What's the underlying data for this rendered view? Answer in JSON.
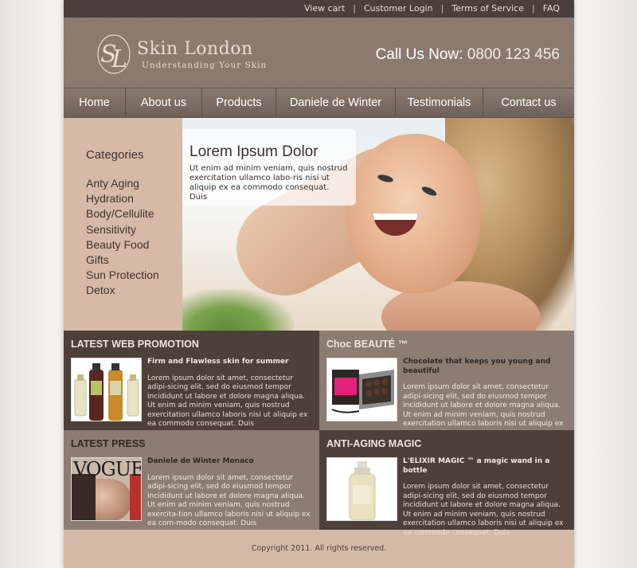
{
  "topbar": {
    "links": [
      "View cart",
      "Customer Login",
      "Terms of Service",
      "FAQ"
    ]
  },
  "header": {
    "logo_name": "Skin London",
    "logo_tagline": "Understanding Your Skin",
    "phone_label": "Call Us Now:",
    "phone_number": "0800 123 456"
  },
  "nav": {
    "items": [
      "Home",
      "About us",
      "Products",
      "Daniele de Winter",
      "Testimonials",
      "Contact us"
    ]
  },
  "categories": {
    "title": "Categories",
    "items": [
      "Anty Aging",
      "Hydration",
      "Body/Cellulite",
      "Sensitivity",
      "Beauty Food",
      "Gifts",
      "Sun Protection",
      "Detox"
    ]
  },
  "hero": {
    "title": "Lorem Ipsum Dolor",
    "text": "Ut enim ad minim veniam, quis nostrud exercitation ullamco labo-ris nisi ut aliquip ex ea commodo consequat. Duis"
  },
  "boxes": {
    "promo": {
      "title": "LATEST WEB PROMOTION",
      "subtitle": "Firm and Flawless skin for summer",
      "text": "Lorem ipsum dolor sit amet, consectetur adipi-sicing elit, sed do eiusmod tempor incididunt ut labore et dolore magna aliqua. Ut enim ad minim veniam, quis nostrud exercitation ullamco laboris nisi ut aliquip ex ea commodo consequat. Duis"
    },
    "choc": {
      "title": "Choc BEAUTÉ ™",
      "subtitle": "Chocolate that keeps you young and beautiful",
      "text": "Lorem ipsum dolor sit amet, consectetur adipi-sicing elit, sed do eiusmod tempor incididunt ut labore et dolore magna aliqua. Ut enim ad minim veniam, quis nostrud exercitation ullamco laboris nisi ut aliquip ex ea commodo consequat."
    },
    "press": {
      "title": "LATEST PRESS",
      "subtitle": "Daniele de Winter Monaco",
      "text": "Lorem ipsum dolor sit amet, consectetur adipi-sicing elit, sed do eiusmod tempor incididunt ut labore et dolore magna aliqua. Ut enim ad minim veniam, quis nostrud exercita-tion ullamco laboris nisi ut aliquip ex ea com-modo consequat. Duis",
      "magazine": "VOGUE"
    },
    "antiaging": {
      "title": "ANTI-AGING MAGIC",
      "subtitle": "L'ELIXIR MAGIC ™ a magic wand in a bottle",
      "text": "Lorem ipsum dolor sit amet, consectetur adipi-sicing elit, sed do eiusmod tempor incididunt ut labore et dolore magna aliqua. Ut enim ad minim veniam, quis nostrud exercitation ullamco laboris nisi ut aliquip ex ea commodo consequat. Duis"
    }
  },
  "footer": {
    "copyright": "Copyright 2011. All rights reserved."
  },
  "colors": {
    "topbar": "#4a3f3a",
    "header": "#8e7c70",
    "categories_bg": "#d7b9a7",
    "box_dark": "#4d4039",
    "box_light": "#8d7c71"
  }
}
